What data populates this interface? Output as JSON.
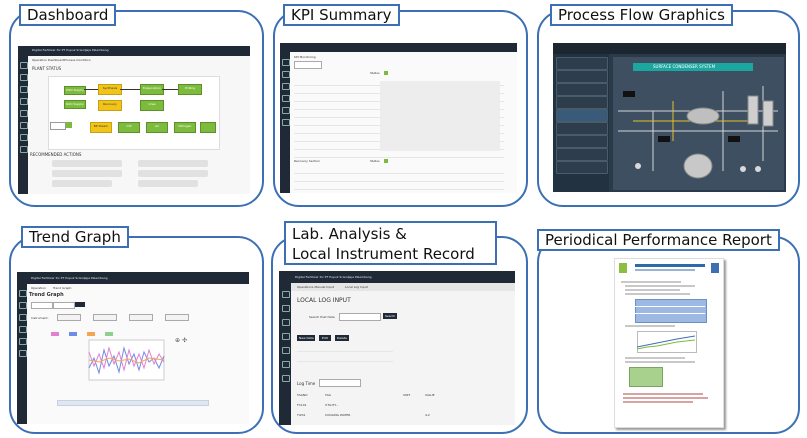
{
  "panels": {
    "dashboard": {
      "label": "Dashboard",
      "app_title": "Digital Fertilizer for PT Pupuk Sriwidjaja Palembang",
      "tabs": [
        "Operation Dashboard",
        "Process Condition"
      ],
      "plant_status": "PLANT STATUS",
      "recommended_actions": "RECOMMENDED ACTIONS",
      "boxes": [
        "H2O Supply",
        "N2O Supply",
        "Synthesis",
        "Recovery",
        "Evaporation",
        "Prilling",
        "BP Steam",
        "CW",
        "Air",
        "Nitrogen",
        "Urea"
      ]
    },
    "kpi": {
      "label": "KPI Summary",
      "section_a": "KPI Monitoring",
      "section_b": "Recovery Section",
      "status": "Status"
    },
    "process_flow": {
      "label": "Process Flow Graphics",
      "system_title": "SURFACE CONDENSER SYSTEM",
      "sidebar": [
        "Home",
        "Operation Dashboard",
        "Operation KPI Summary",
        "Operation Trendgraph",
        "Operation Flow Graphic",
        "Maintenance Dashboard",
        "Maintenance Monitoring",
        "Reporting",
        "Alarms"
      ]
    },
    "trend": {
      "label": "Trend Graph",
      "app_title": "Digital Fertilizer for PT Pupuk Sriwidjaja Palembang",
      "tabs": [
        "Operation",
        "Trend Graph"
      ],
      "page_title": "Trend Graph",
      "instrument": "Instrument:"
    },
    "lab": {
      "label_line1": "Lab. Analysis &",
      "label_line2": "Local Instrument Record",
      "app_title": "Digital Fertilizer for PT Pupuk Sriwidjaja Palembang",
      "tabs": [
        "Operations Manual Input",
        "Local Log Input"
      ],
      "page_title": "LOCAL LOG INPUT",
      "search_label": "Search Post Date",
      "search_button": "Search",
      "buttons": [
        "New Data",
        "Edit",
        "Delete"
      ],
      "log_time": "Log Time",
      "table_headers": [
        "TAGNO",
        "TAG",
        "UNIT",
        "VALUE"
      ],
      "rows": [
        [
          "FC101",
          "UTILITY...",
          "",
          ""
        ],
        [
          "TI201",
          "COOLING WATER",
          "",
          "4,2"
        ]
      ]
    },
    "report": {
      "label": "Periodical Performance Report"
    }
  }
}
